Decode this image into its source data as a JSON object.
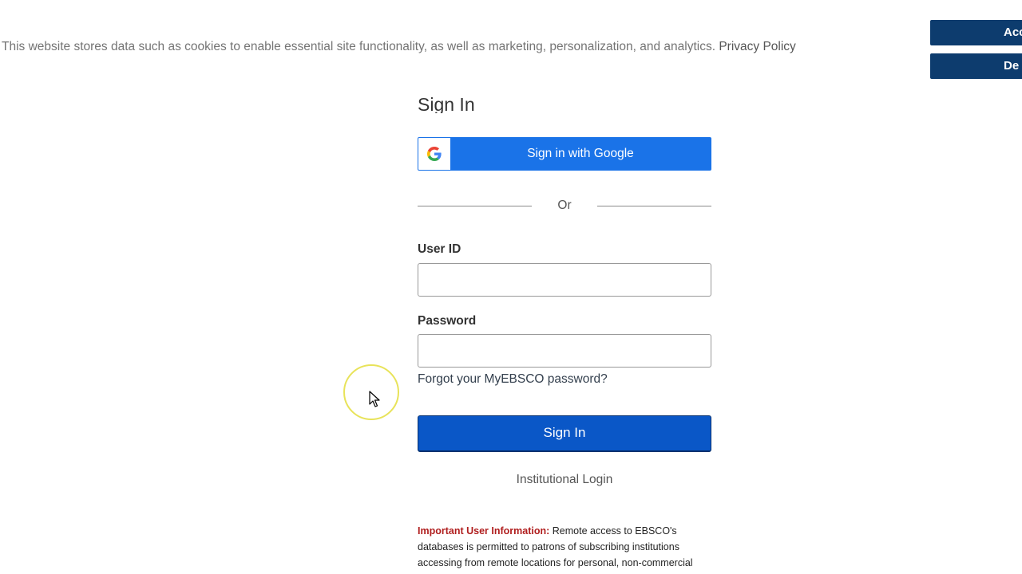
{
  "cookie_banner": {
    "message": "This website stores data such as cookies to enable essential site functionality, as well as marketing, personalization, and analytics. ",
    "privacy_link": "Privacy Policy",
    "accept_label": "Acc",
    "decline_label": "De"
  },
  "signin": {
    "title": "Sign In",
    "google_button": "Sign in with Google",
    "or_text": "Or",
    "userid_label": "User ID",
    "userid_value": "",
    "password_label": "Password",
    "password_value": "",
    "forgot_link": "Forgot your MyEBSCO password?",
    "submit_label": "Sign In",
    "institutional_link": "Institutional Login"
  },
  "important_info": {
    "label": "Important User Information:",
    "text": " Remote access to EBSCO's databases is permitted to patrons of subscribing institutions accessing from remote locations for personal, non-commercial use. However, remote access to EBSCO's databases from"
  },
  "colors": {
    "cookie_button": "#0d3c6e",
    "google_blue": "#1a73e8",
    "signin_button": "#0a57c7",
    "important_label": "#b01e1e",
    "cursor_ring": "#e8e35a"
  },
  "icons": {
    "google": "google-g-icon",
    "cursor": "mouse-pointer-icon"
  }
}
